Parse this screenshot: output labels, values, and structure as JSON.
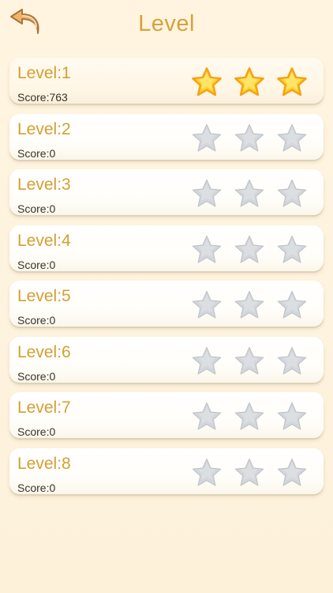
{
  "header": {
    "title": "Level",
    "back_icon": "back-arrow-icon"
  },
  "colors": {
    "accent_text": "#d6a23c",
    "star_earned_fill": "#ffd733",
    "star_earned_stroke": "#f6a313",
    "star_empty_fill": "#d3d7db",
    "star_empty_stroke": "#bfc4c8"
  },
  "levels": [
    {
      "label": "Level:1",
      "score": "Score:763",
      "stars_earned": 3,
      "stars_total": 3
    },
    {
      "label": "Level:2",
      "score": "Score:0",
      "stars_earned": 0,
      "stars_total": 3
    },
    {
      "label": "Level:3",
      "score": "Score:0",
      "stars_earned": 0,
      "stars_total": 3
    },
    {
      "label": "Level:4",
      "score": "Score:0",
      "stars_earned": 0,
      "stars_total": 3
    },
    {
      "label": "Level:5",
      "score": "Score:0",
      "stars_earned": 0,
      "stars_total": 3
    },
    {
      "label": "Level:6",
      "score": "Score:0",
      "stars_earned": 0,
      "stars_total": 3
    },
    {
      "label": "Level:7",
      "score": "Score:0",
      "stars_earned": 0,
      "stars_total": 3
    },
    {
      "label": "Level:8",
      "score": "Score:0",
      "stars_earned": 0,
      "stars_total": 3
    }
  ]
}
